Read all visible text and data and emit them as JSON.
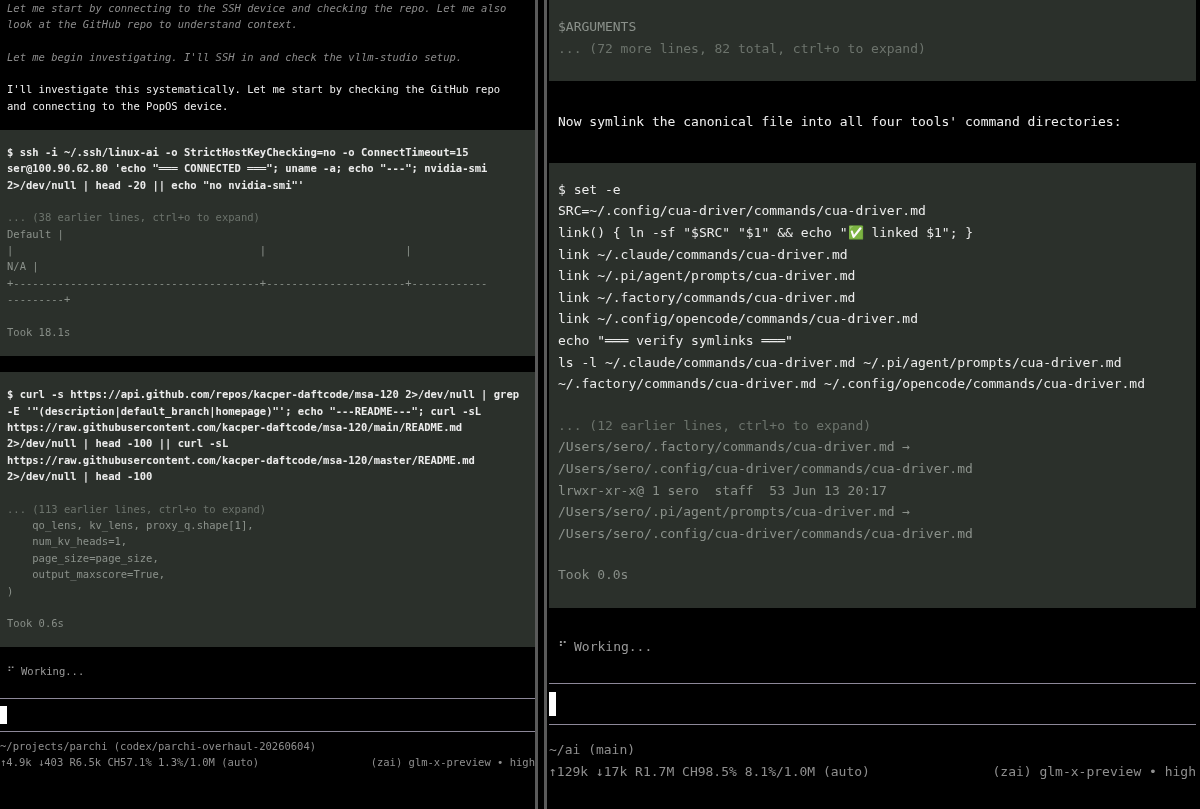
{
  "panes": [
    {
      "blocks": [
        {
          "kind": "thinking",
          "text": "Let me start by connecting to the SSH device and checking the repo. Let me also\nlook at the GitHub repo to understand context."
        },
        {
          "kind": "thinking",
          "text": "Let me begin investigating. I'll SSH in and check the vllm-studio setup."
        },
        {
          "kind": "text",
          "text": "I'll investigate this systematically. Let me start by checking the GitHub repo\nand connecting to the PopOS device."
        },
        {
          "kind": "tool",
          "command": "$ ssh -i ~/.ssh/linux-ai -o StrictHostKeyChecking=no -o ConnectTimeout=15\nser@100.90.62.80 'echo \"═══ CONNECTED ═══\"; uname -a; echo \"---\"; nvidia-smi\n2>/dev/null | head -20 || echo \"no nvidia-smi\"'",
          "output": [
            {
              "kind": "hint",
              "text": "... (38 earlier lines, ctrl+o to expand)"
            },
            {
              "kind": "line",
              "text": "Default |"
            },
            {
              "kind": "line",
              "text": "|                                       |                      |"
            },
            {
              "kind": "line",
              "text": "N/A |"
            },
            {
              "kind": "line",
              "text": "+---------------------------------------+----------------------+------------"
            },
            {
              "kind": "line",
              "text": "---------+"
            }
          ],
          "took": "Took 18.1s"
        },
        {
          "kind": "tool",
          "command": "$ curl -s https://api.github.com/repos/kacper-daftcode/msa-120 2>/dev/null | grep\n-E '\"(description|default_branch|homepage)\"'; echo \"---README---\"; curl -sL\nhttps://raw.githubusercontent.com/kacper-daftcode/msa-120/main/README.md\n2>/dev/null | head -100 || curl -sL\nhttps://raw.githubusercontent.com/kacper-daftcode/msa-120/master/README.md\n2>/dev/null | head -100",
          "output": [
            {
              "kind": "hint",
              "text": "... (113 earlier lines, ctrl+o to expand)"
            },
            {
              "kind": "line",
              "text": "    qo_lens, kv_lens, proxy_q.shape[1],"
            },
            {
              "kind": "line",
              "text": "    num_kv_heads=1,"
            },
            {
              "kind": "line",
              "text": "    page_size=page_size,"
            },
            {
              "kind": "line",
              "text": "    output_maxscore=True,"
            },
            {
              "kind": "line",
              "text": ")"
            }
          ],
          "took": "Took 0.6s"
        }
      ],
      "spinner": "⠋",
      "status": "Working...",
      "cwd": "~/projects/parchi (codex/parchi-overhaul-20260604)",
      "stats": "↑4.9k ↓403 R6.5k CH57.1% 1.3%/1.0M (auto)",
      "model": "(zai) glm-x-preview • high"
    },
    {
      "blocks": [
        {
          "kind": "tool",
          "output": [
            {
              "kind": "line",
              "text": "$ARGUMENTS"
            },
            {
              "kind": "hint",
              "text": "... (72 more lines, 82 total, ctrl+o to expand)"
            }
          ]
        },
        {
          "kind": "text",
          "text": "Now symlink the canonical file into all four tools' command directories:"
        },
        {
          "kind": "tool",
          "command": "$ set -e\nSRC=~/.config/cua-driver/commands/cua-driver.md\nlink() { ln -sf \"$SRC\" \"$1\" && echo \"✅ linked $1\"; }\nlink ~/.claude/commands/cua-driver.md\nlink ~/.pi/agent/prompts/cua-driver.md\nlink ~/.factory/commands/cua-driver.md\nlink ~/.config/opencode/commands/cua-driver.md\necho \"═══ verify symlinks ═══\"\nls -l ~/.claude/commands/cua-driver.md ~/.pi/agent/prompts/cua-driver.md\n~/.factory/commands/cua-driver.md ~/.config/opencode/commands/cua-driver.md",
          "output": [
            {
              "kind": "hint",
              "text": "... (12 earlier lines, ctrl+o to expand)"
            },
            {
              "kind": "line",
              "text": "/Users/sero/.factory/commands/cua-driver.md →"
            },
            {
              "kind": "line",
              "text": "/Users/sero/.config/cua-driver/commands/cua-driver.md"
            },
            {
              "kind": "line",
              "text": "lrwxr-xr-x@ 1 sero  staff  53 Jun 13 20:17"
            },
            {
              "kind": "line",
              "text": "/Users/sero/.pi/agent/prompts/cua-driver.md →"
            },
            {
              "kind": "line",
              "text": "/Users/sero/.config/cua-driver/commands/cua-driver.md"
            }
          ],
          "took": "Took 0.0s"
        }
      ],
      "spinner": "⠋",
      "status": "Working...",
      "cwd": "~/ai (main)",
      "stats": "↑129k ↓17k R1.7M CH98.5% 8.1%/1.0M (auto)",
      "model": "(zai) glm-x-preview • high"
    }
  ]
}
